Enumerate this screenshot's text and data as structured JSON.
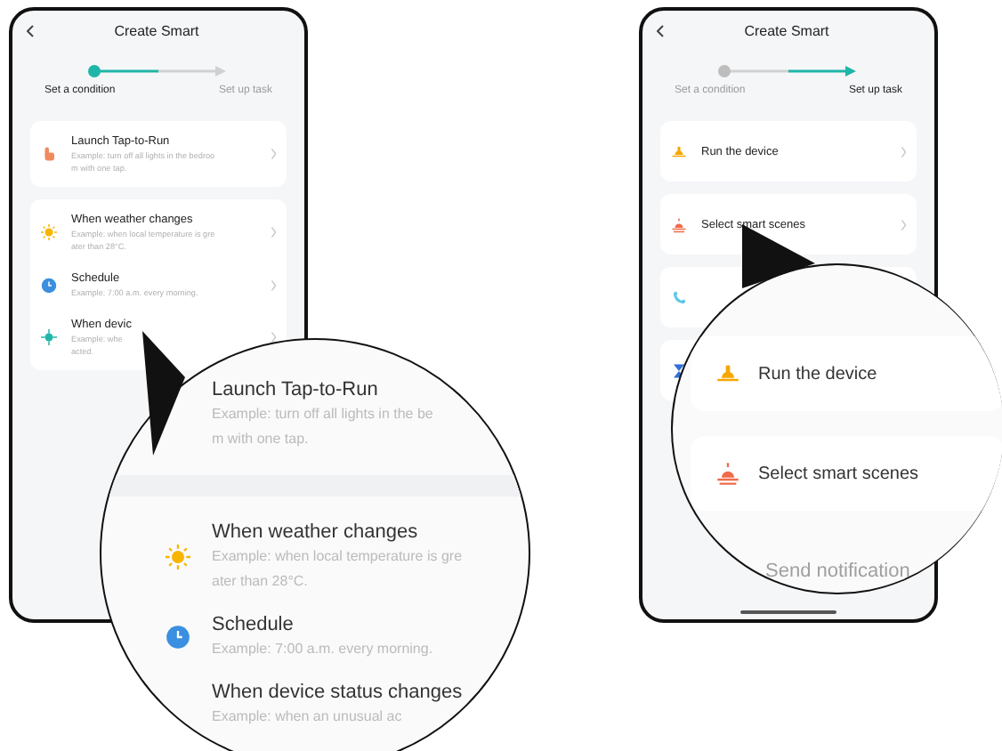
{
  "screens": [
    {
      "title": "Create Smart",
      "steps": [
        {
          "label": "Set a condition",
          "selected": true
        },
        {
          "label": "Set up task",
          "selected": false
        }
      ],
      "groups": [
        [
          {
            "kind": "hand",
            "title": "Launch Tap-to-Run",
            "desc": [
              "Example: turn off all lights in the bedroo",
              "m with one tap."
            ]
          }
        ],
        [
          {
            "kind": "sun",
            "title": "When weather changes",
            "desc": [
              "Example: when local temperature is gre",
              "ater than 28°C."
            ]
          },
          {
            "kind": "clock",
            "title": "Schedule",
            "desc": [
              "Example: 7:00 a.m. every morning."
            ]
          },
          {
            "kind": "device",
            "title": "When devic",
            "desc": [
              "Example: whe",
              "acted."
            ]
          }
        ]
      ],
      "magnifier": {
        "kind": "list",
        "items": [
          {
            "kind": "text",
            "title": "Launch Tap-to-Run",
            "desc": [
              "Example: turn off all lights in the be",
              "m with one tap."
            ]
          },
          {
            "kind": "sun",
            "title": "When weather changes",
            "desc": [
              "Example: when local temperature is gre",
              "ater than 28°C."
            ]
          },
          {
            "kind": "clock",
            "title": "Schedule",
            "desc": [
              "Example: 7:00 a.m. every morning."
            ]
          },
          {
            "kind": "text",
            "title": "When device status changes",
            "desc": [
              "Example: when an unusual ac"
            ]
          }
        ]
      }
    },
    {
      "title": "Create Smart",
      "steps": [
        {
          "label": "Set a condition",
          "selected": false
        },
        {
          "label": "Set up task",
          "selected": true
        }
      ],
      "groups": [
        [
          {
            "kind": "lamp",
            "title": "Run the device"
          }
        ],
        [
          {
            "kind": "scenes",
            "title": "Select smart scenes"
          }
        ],
        [
          {
            "kind": "phone"
          }
        ],
        [
          {
            "kind": "hourglass"
          }
        ]
      ],
      "magnifier": {
        "kind": "cards",
        "items": [
          {
            "kind": "lamp",
            "title": "Run the device",
            "faded": false
          },
          {
            "kind": "scenes",
            "title": "Select smart scenes",
            "faded": false
          },
          {
            "kind": "text",
            "title": "Send notification",
            "faded": true
          }
        ]
      }
    }
  ]
}
